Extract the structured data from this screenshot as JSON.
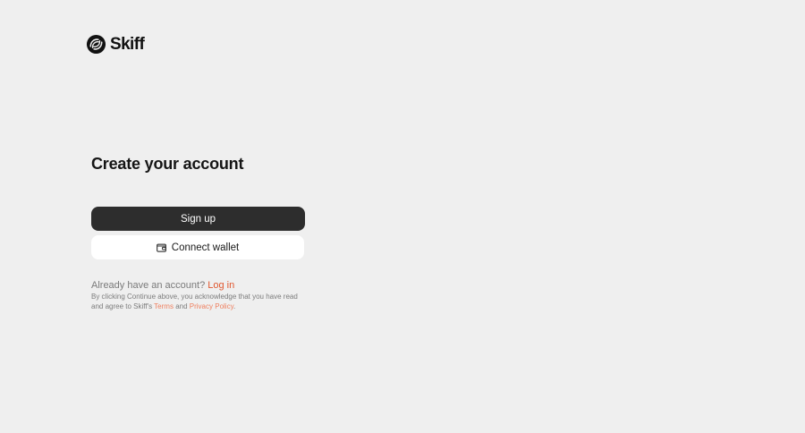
{
  "brand": {
    "name": "Skiff"
  },
  "signup": {
    "title": "Create your account",
    "signup_label": "Sign up",
    "connect_wallet_label": "Connect wallet",
    "login_prompt": "Already have an account?",
    "login_link": "Log in",
    "legal_prefix": "By clicking Continue above, you acknowledge that you have read and agree to Skiff's",
    "terms_link": "Terms",
    "legal_and": "and",
    "privacy_link": "Privacy Policy",
    "legal_suffix": "."
  },
  "icons": {
    "logo": "skiff-logo-icon",
    "wallet": "wallet-icon"
  },
  "colors": {
    "background": "#efefef",
    "primary_button": "#2d2d2d",
    "accent": "#e0572f"
  }
}
